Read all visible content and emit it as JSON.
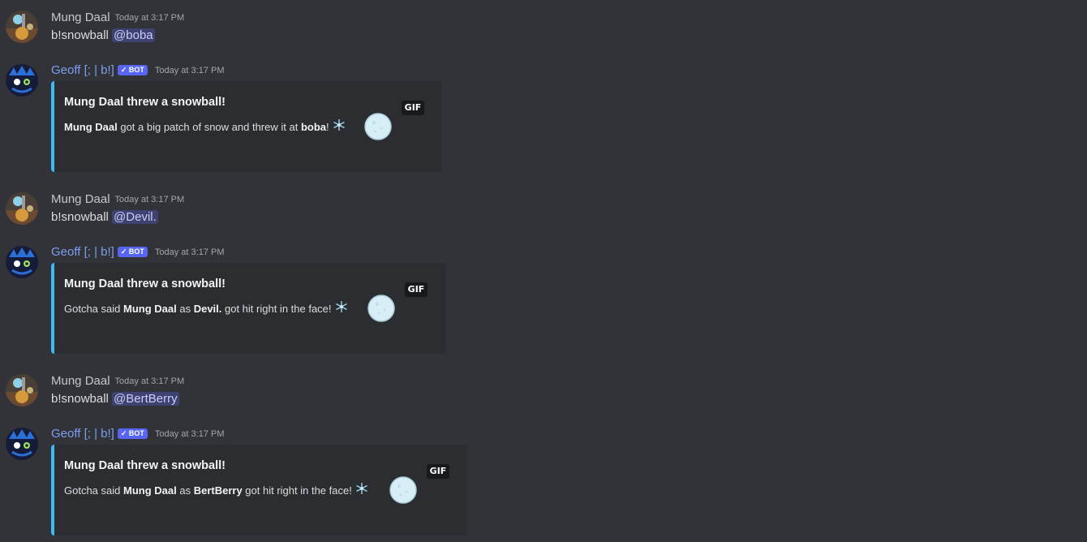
{
  "messages": [
    {
      "kind": "user",
      "author": "Mung Daal",
      "timestamp": "Today at 3:17 PM",
      "command": "b!snowball ",
      "mention": "@boba"
    },
    {
      "kind": "bot",
      "author": "Geoff [; | b!]",
      "bot_tag": "✓ BOT",
      "timestamp": "Today at 3:17 PM",
      "embed": {
        "title": "Mung Daal threw a snowball!",
        "desc_parts": [
          "",
          "Mung Daal",
          " got a big patch of snow and threw it at ",
          "boba",
          "!"
        ],
        "gif_label": "GIF"
      }
    },
    {
      "kind": "user",
      "author": "Mung Daal",
      "timestamp": "Today at 3:17 PM",
      "command": "b!snowball ",
      "mention": "@Devil."
    },
    {
      "kind": "bot",
      "author": "Geoff [; | b!]",
      "bot_tag": "✓ BOT",
      "timestamp": "Today at 3:17 PM",
      "embed": {
        "title": "Mung Daal threw a snowball!",
        "desc_parts": [
          "Gotcha said ",
          "Mung Daal",
          " as ",
          "Devil.",
          " got hit right in the face!"
        ],
        "gif_label": "GIF"
      }
    },
    {
      "kind": "user",
      "author": "Mung Daal",
      "timestamp": "Today at 3:17 PM",
      "command": "b!snowball ",
      "mention": "@BertBerry"
    },
    {
      "kind": "bot",
      "author": "Geoff [; | b!]",
      "bot_tag": "✓ BOT",
      "timestamp": "Today at 3:17 PM",
      "embed": {
        "title": "Mung Daal threw a snowball!",
        "desc_parts": [
          "Gotcha said ",
          "Mung Daal",
          " as ",
          "BertBerry",
          " got hit right in the face!"
        ],
        "gif_label": "GIF"
      }
    }
  ],
  "icons": {
    "user_avatar": "mung-daal-avatar",
    "bot_avatar": "geoff-bot-avatar",
    "snowflake": "snowflake-icon",
    "snowball": "snowball-image"
  },
  "colors": {
    "background": "#313338",
    "embed_background": "#2b2d31",
    "embed_accent": "#3fb8f3",
    "mention_background": "#3e4270",
    "bot_tag": "#5865f2",
    "bot_name": "#7c9ff0"
  }
}
